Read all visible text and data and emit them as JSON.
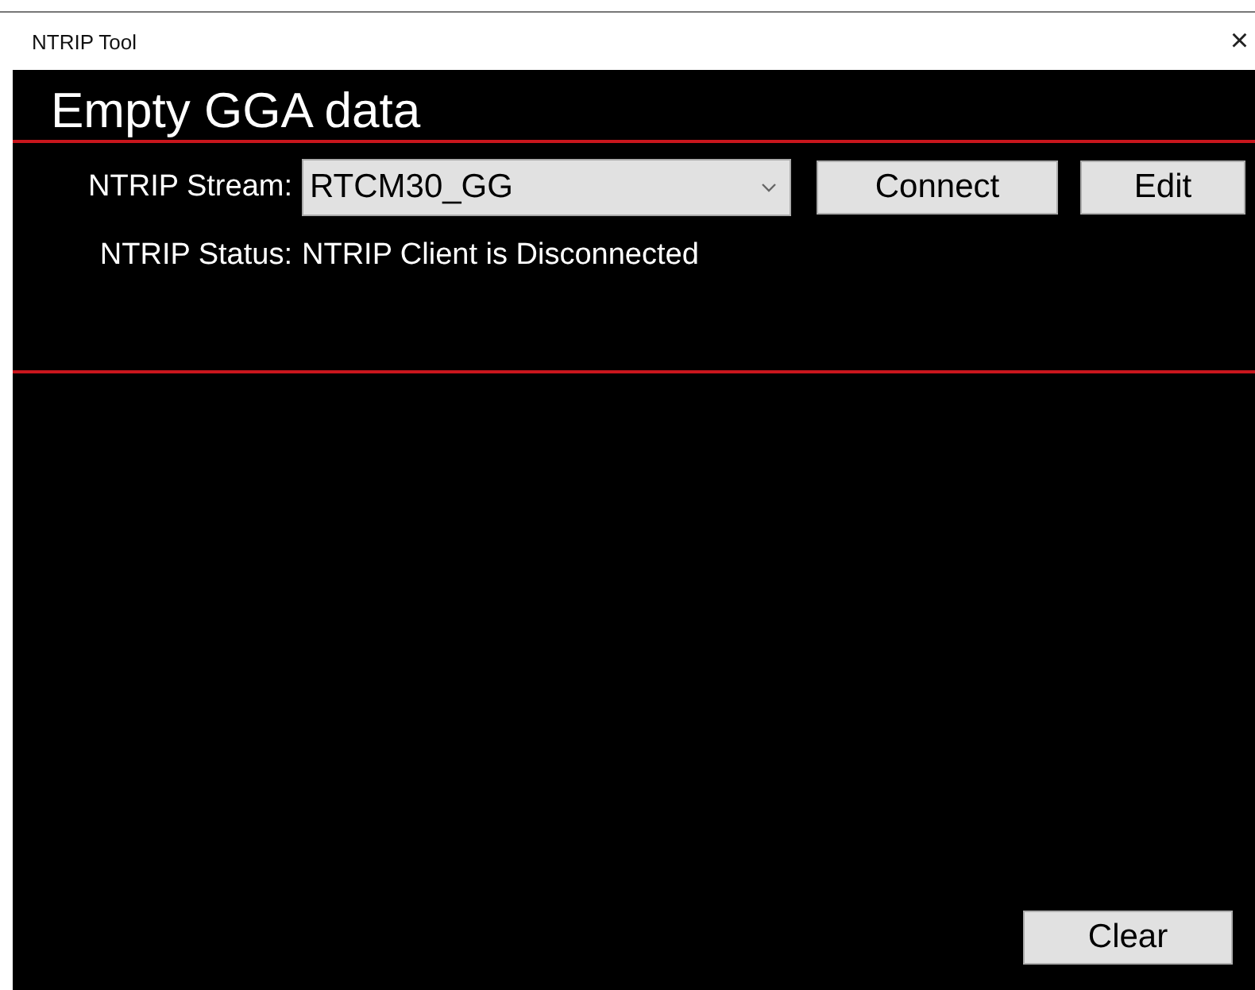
{
  "window": {
    "title": "NTRIP Tool",
    "close": "×"
  },
  "heading": "Empty GGA data",
  "stream": {
    "label": "NTRIP Stream:",
    "value": "RTCM30_GG"
  },
  "buttons": {
    "connect": "Connect",
    "edit": "Edit",
    "clear": "Clear"
  },
  "status": {
    "label": "NTRIP Status:",
    "value": "NTRIP Client is Disconnected"
  }
}
